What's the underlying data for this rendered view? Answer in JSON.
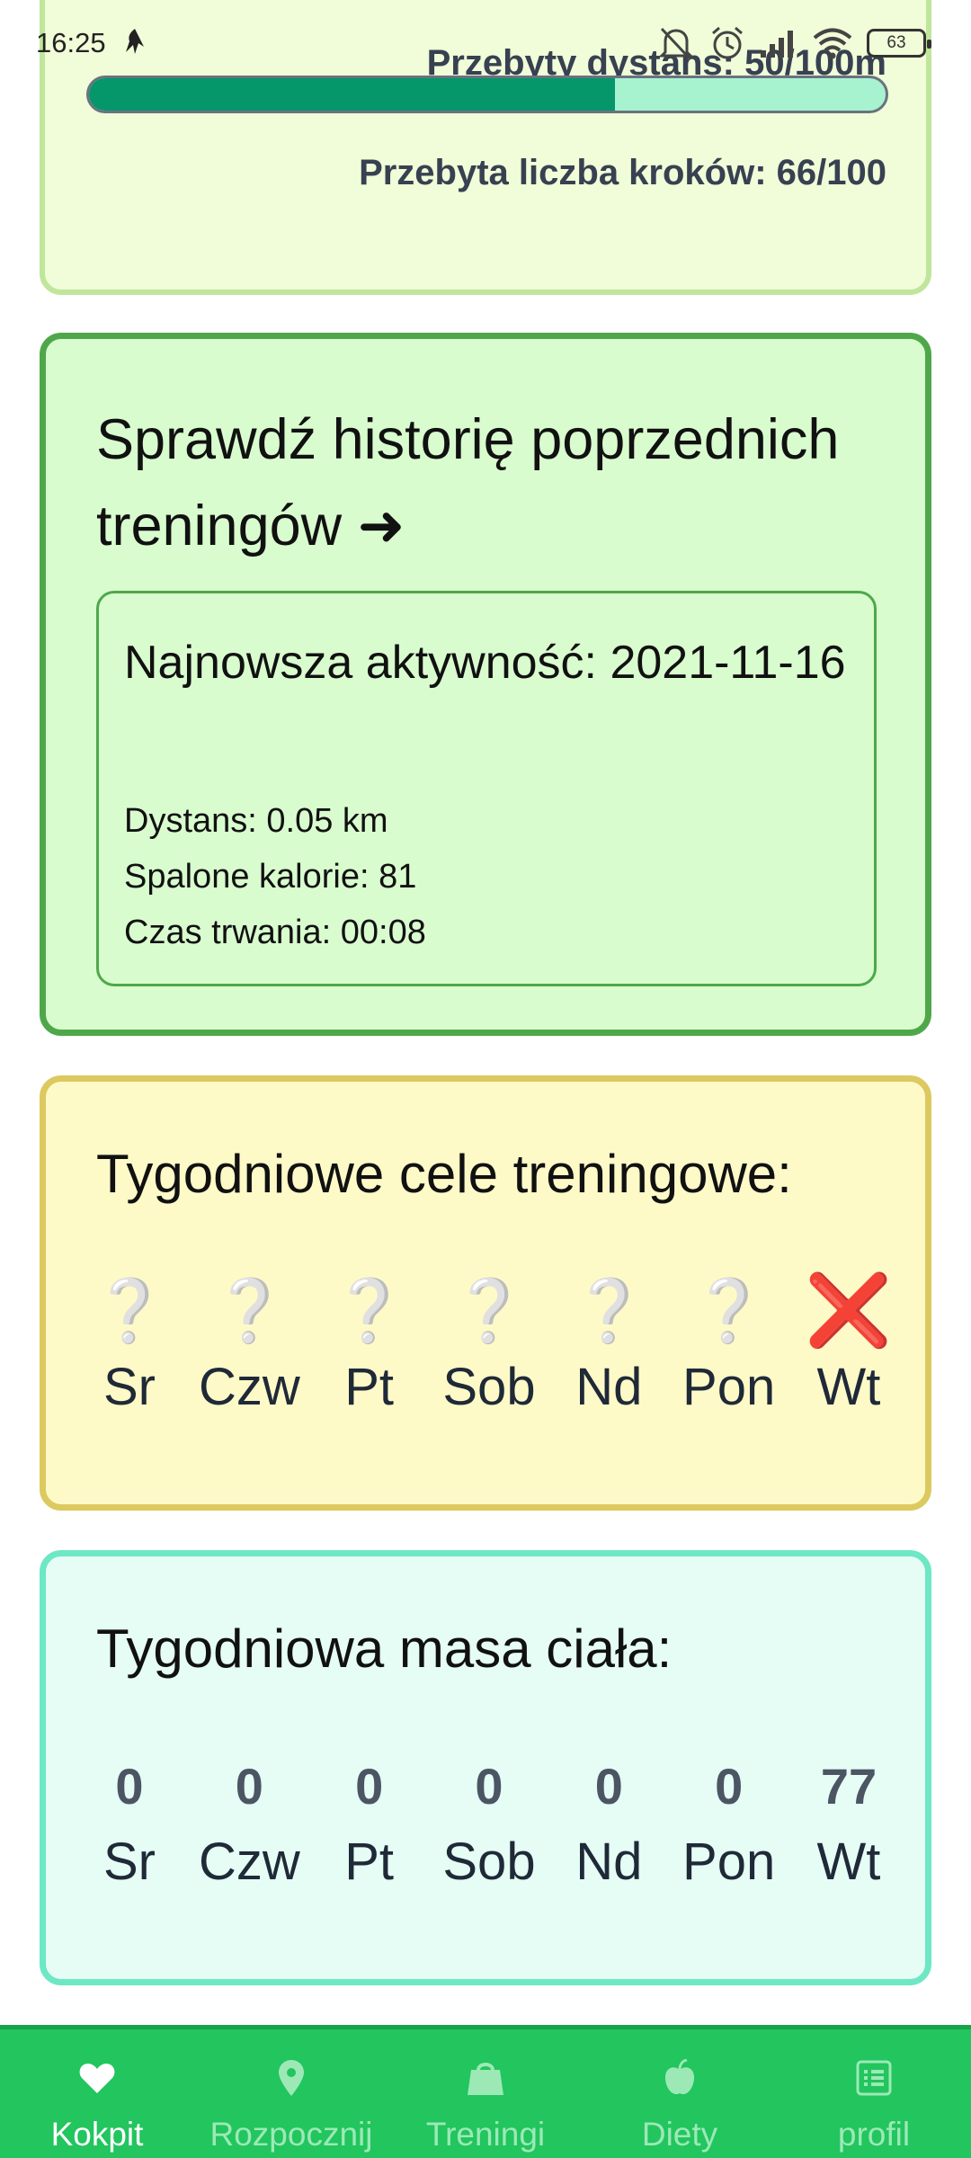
{
  "status_bar": {
    "time": "16:25",
    "battery": "63"
  },
  "progress_card": {
    "distance_text": "Przebyty dystans: 50/100m",
    "distance_progress": 0.66,
    "steps_text": "Przebyta liczba kroków: 66/100"
  },
  "history_card": {
    "title": "Sprawdź historię poprzednich treningów ➜",
    "latest_label": "Najnowsza aktywność: 2021-11-16",
    "distance": "Dystans: 0.05 km",
    "calories": "Spalone kalorie: 81",
    "duration": "Czas trwania: 00:08"
  },
  "goals_card": {
    "title": "Tygodniowe cele treningowe:",
    "days": [
      {
        "label": "Sr",
        "mark": "❔",
        "status": "unknown"
      },
      {
        "label": "Czw",
        "mark": "❔",
        "status": "unknown"
      },
      {
        "label": "Pt",
        "mark": "❔",
        "status": "unknown"
      },
      {
        "label": "Sob",
        "mark": "❔",
        "status": "unknown"
      },
      {
        "label": "Nd",
        "mark": "❔",
        "status": "unknown"
      },
      {
        "label": "Pon",
        "mark": "❔",
        "status": "unknown"
      },
      {
        "label": "Wt",
        "mark": "❌",
        "status": "failed"
      }
    ]
  },
  "weight_card": {
    "title": "Tygodniowa masa ciała:",
    "days": [
      {
        "label": "Sr",
        "value": "0"
      },
      {
        "label": "Czw",
        "value": "0"
      },
      {
        "label": "Pt",
        "value": "0"
      },
      {
        "label": "Sob",
        "value": "0"
      },
      {
        "label": "Nd",
        "value": "0"
      },
      {
        "label": "Pon",
        "value": "0"
      },
      {
        "label": "Wt",
        "value": "77"
      }
    ]
  },
  "bottom_nav": {
    "items": [
      {
        "label": "Kokpit",
        "icon": "heart-icon",
        "active": true
      },
      {
        "label": "Rozpocznij",
        "icon": "map-pin-icon",
        "active": false
      },
      {
        "label": "Treningi",
        "icon": "bag-icon",
        "active": false
      },
      {
        "label": "Diety",
        "icon": "apple-icon",
        "active": false
      },
      {
        "label": "profil",
        "icon": "list-icon",
        "active": false
      }
    ]
  },
  "colors": {
    "nav_bg": "#22c55e",
    "progress_fill": "#059669",
    "progress_track": "#a7f3d0",
    "history_border": "#4ea84a",
    "goals_border": "#dcc95f",
    "weight_border": "#6ee7c4"
  }
}
